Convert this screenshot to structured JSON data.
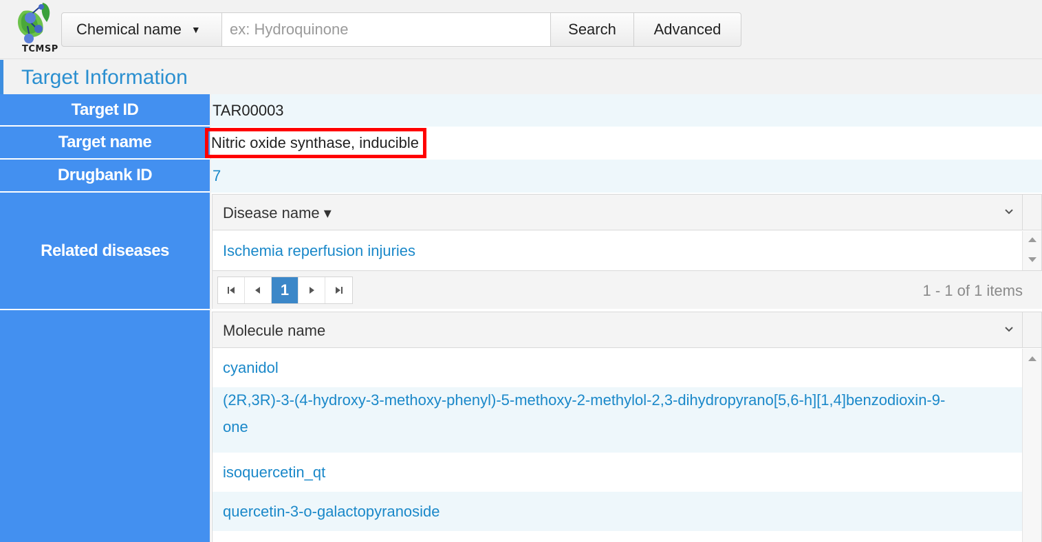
{
  "header": {
    "logo_text": "TCMSP",
    "search_type": "Chemical name",
    "search_placeholder": "ex: Hydroquinone",
    "search_button": "Search",
    "advanced_button": "Advanced"
  },
  "section_title": "Target Information",
  "info": {
    "target_id_label": "Target ID",
    "target_id_value": "TAR00003",
    "target_name_label": "Target name",
    "target_name_value": "Nitric oxide synthase, inducible",
    "drugbank_label": "Drugbank ID",
    "drugbank_value": "7",
    "related_diseases_label": "Related diseases"
  },
  "diseases_grid": {
    "column": "Disease name ▾",
    "rows": [
      "Ischemia reperfusion injuries"
    ],
    "current_page": "1",
    "pager_info": "1 - 1 of 1 items"
  },
  "molecules_grid": {
    "column": "Molecule name",
    "rows": [
      "cyanidol",
      "(2R,3R)-3-(4-hydroxy-3-methoxy-phenyl)-5-methoxy-2-methylol-2,3-dihydropyrano[5,6-h][1,4]benzodioxin-9-",
      "one",
      "isoquercetin_qt",
      "quercetin-3-o-galactopyranoside"
    ]
  },
  "colors": {
    "label_bg": "#4390f0",
    "link": "#1a88c9",
    "title": "#2a8fd0",
    "highlight": "#ff0000"
  }
}
